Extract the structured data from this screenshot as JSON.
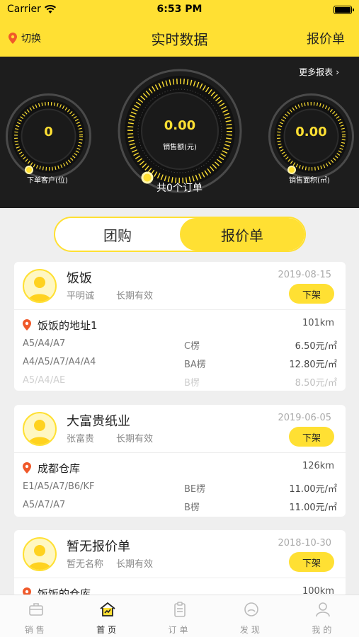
{
  "status_bar": {
    "carrier": "Carrier",
    "time": "6:53 PM"
  },
  "nav": {
    "location_label": "切换",
    "title": "实时数据",
    "right_label": "报价单"
  },
  "dashboard": {
    "more_label": "更多报表",
    "left": {
      "value": "0",
      "label": "下单客户(位)"
    },
    "center": {
      "value": "0.00",
      "label": "销售额(元)"
    },
    "right": {
      "value": "0.00",
      "label": "销售面积(㎡)"
    },
    "orders_label": "共0个订单"
  },
  "segment": {
    "tabs": [
      "团购",
      "报价单"
    ],
    "active_index": 1
  },
  "cards": [
    {
      "name": "饭饭",
      "contact": "平明诚",
      "validity": "长期有效",
      "date": "2019-08-15",
      "action": "下架",
      "address": "饭饭的地址1",
      "distance": "101km",
      "rows": [
        {
          "spec": "A5/A4/A7",
          "grade": "C楞",
          "price": "6.50元/㎡"
        },
        {
          "spec": "A4/A5/A7/A4/A4",
          "grade": "BA楞",
          "price": "12.80元/㎡"
        },
        {
          "spec": "A5/A4/AE",
          "grade": "B楞",
          "price": "8.50元/㎡"
        }
      ]
    },
    {
      "name": "大富贵纸业",
      "contact": "张富贵",
      "validity": "长期有效",
      "date": "2019-06-05",
      "action": "下架",
      "address": "成都仓库",
      "distance": "126km",
      "rows": [
        {
          "spec": "E1/A5/A7/B6/KF",
          "grade": "BE楞",
          "price": "11.00元/㎡"
        },
        {
          "spec": "A5/A7/A7",
          "grade": "B楞",
          "price": "11.00元/㎡"
        }
      ]
    },
    {
      "name": "暂无报价单",
      "contact": "暂无名称",
      "validity": "长期有效",
      "date": "2018-10-30",
      "action": "下架",
      "address": "饭饭的仓库",
      "distance": "100km",
      "rows": []
    }
  ],
  "tabbar": {
    "items": [
      "销售",
      "首页",
      "订单",
      "发现",
      "我的"
    ],
    "active_index": 1
  },
  "colors": {
    "accent": "#ffe033",
    "dark": "#1d1d1d",
    "pin": "#f0592a"
  },
  "icons": [
    "wifi-icon",
    "battery-icon",
    "location-pin-icon",
    "chevron-right-icon",
    "avatar-icon",
    "briefcase-icon",
    "home-icon",
    "clipboard-icon",
    "compass-icon",
    "person-icon"
  ]
}
